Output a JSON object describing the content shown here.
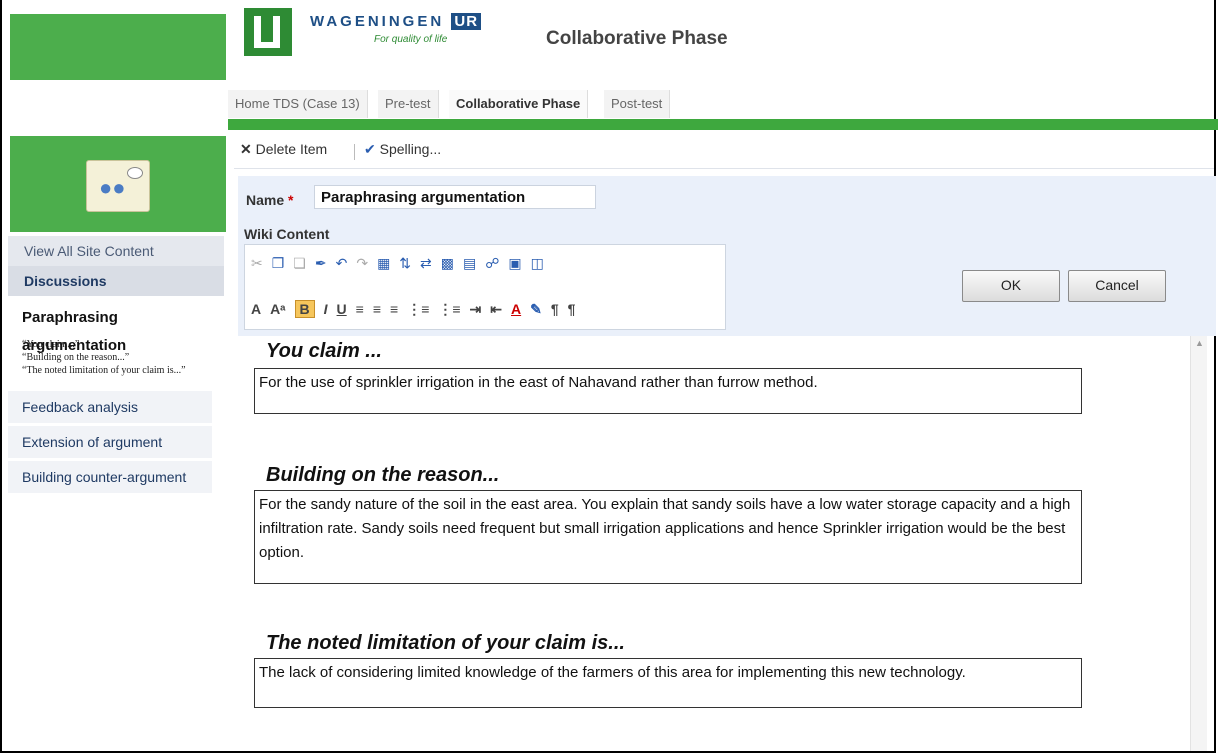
{
  "header": {
    "logo_name": "WAGENINGEN",
    "logo_ur": "UR",
    "logo_tagline": "For quality of life",
    "page_title": "Collaborative Phase"
  },
  "tabs": [
    {
      "label": "Home TDS (Case 13)"
    },
    {
      "label": "Pre-test"
    },
    {
      "label": "Collaborative Phase",
      "active": true
    },
    {
      "label": "Post-test"
    }
  ],
  "toolbar": {
    "delete_label": "Delete Item",
    "spelling_label": "Spelling..."
  },
  "sidebar": {
    "view_all": "View All Site Content",
    "discussions": "Discussions",
    "current_page": "Paraphrasing argumentation",
    "sub_items": [
      "“You claim...”",
      "“Building on the reason...”",
      "“The noted limitation of your claim is...”"
    ],
    "nav_items": [
      "Feedback analysis",
      "Extension of argument",
      "Building counter-argument"
    ]
  },
  "form": {
    "name_label": "Name",
    "required_mark": "*",
    "name_value": "Paraphrasing argumentation",
    "wiki_label": "Wiki Content",
    "ok_label": "OK",
    "cancel_label": "Cancel"
  },
  "content": {
    "sections": [
      {
        "title": "You claim ...",
        "body": "For the use of sprinkler irrigation in the east of Nahavand rather than furrow method."
      },
      {
        "title": "Building on the reason...",
        "body": "For the sandy nature of the soil in the east area. You explain that sandy soils have a low water storage capacity and a high infiltration rate. Sandy soils need frequent but small irrigation applications and hence Sprinkler irrigation would be the best option."
      },
      {
        "title": "The noted limitation of your claim is...",
        "body": "The lack of considering limited knowledge of the farmers of this area for implementing this new technology."
      }
    ]
  },
  "colors": {
    "brand_green": "#3ea83e",
    "brand_blue": "#1e4f86",
    "form_bg": "#eaf0fa"
  }
}
